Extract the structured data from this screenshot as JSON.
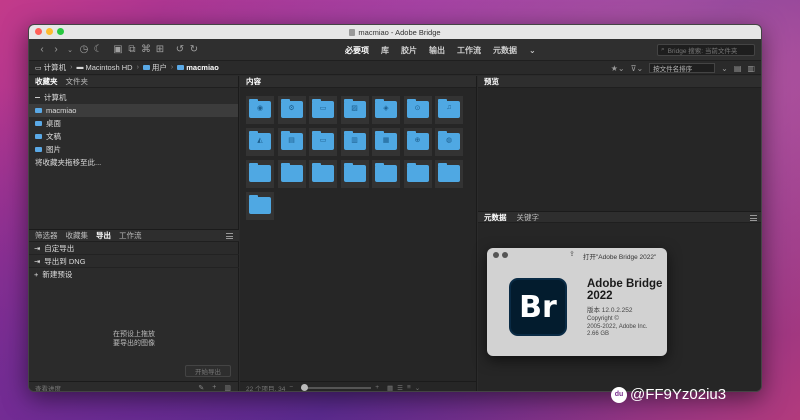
{
  "window": {
    "title": "macmiao - Adobe Bridge",
    "traffic_colors": [
      "#ff5f57",
      "#febc2e",
      "#28c840"
    ]
  },
  "toolbar": {
    "workspaces": [
      "必要项",
      "库",
      "胶片",
      "输出",
      "工作流",
      "元数据"
    ],
    "active_workspace": "必要项",
    "more": "⌄",
    "search_placeholder": "Bridge 搜索: 当前文件夹"
  },
  "pathbar": {
    "crumbs": [
      "计算机",
      "Macintosh HD",
      "用户",
      "macmiao"
    ],
    "sort_label": "按文件名排序"
  },
  "left_panel": {
    "tabs": [
      "收藏夹",
      "文件夹"
    ],
    "active_tab": "收藏夹",
    "favorites": [
      "计算机",
      "macmiao",
      "桌面",
      "文稿",
      "图片"
    ],
    "selected_favorite": "macmiao",
    "drag_hint": "将收藏夹拖移至此..."
  },
  "lower_panel": {
    "tabs": [
      "筛选器",
      "收藏集",
      "导出",
      "工作流"
    ],
    "active_tab": "导出",
    "items": [
      "自定导出",
      "导出到 DNG",
      "新建预设"
    ],
    "hint_line1": "在预设上拖放",
    "hint_line2": "要导出的图像",
    "start_export": "开始导出",
    "footer": "查看进度"
  },
  "content_panel": {
    "header": "内容",
    "folder_count": 22,
    "footer_status": "22 个项目, 34"
  },
  "right_panel": {
    "preview_header": "预览",
    "meta_tabs": [
      "元数据",
      "关键字"
    ],
    "active_meta_tab": "元数据"
  },
  "about_dialog": {
    "title": "打开\"Adobe Bridge 2022\"",
    "logo_text": "Br",
    "name_line1": "Adobe Bridge",
    "name_line2": "2022",
    "version": "版本 12.0.2.252",
    "copyright_line1": "Copyright ©",
    "copyright_line2": "2005-2022, Adobe Inc.",
    "copyright_line3": "2.66 GB"
  },
  "watermark": {
    "text": "@FF9Yz02iu3",
    "badge": "du"
  }
}
